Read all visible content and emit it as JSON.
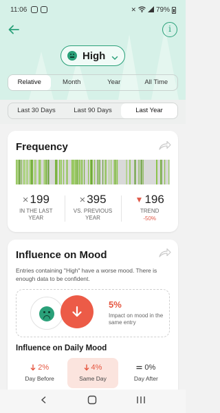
{
  "status_bar": {
    "time": "11:06",
    "battery": "79%"
  },
  "header": {
    "mood_label": "High",
    "mood_color": "#2aa079",
    "range_tabs": [
      {
        "label": "Relative",
        "active": true
      },
      {
        "label": "Month",
        "active": false
      },
      {
        "label": "Year",
        "active": false
      },
      {
        "label": "All Time",
        "active": false
      }
    ],
    "period_tabs": [
      {
        "label": "Last 30 Days",
        "active": false
      },
      {
        "label": "Last 90 Days",
        "active": false
      },
      {
        "label": "Last Year",
        "active": true
      }
    ]
  },
  "frequency": {
    "title": "Frequency",
    "stats": [
      {
        "prefix": "×",
        "value": "199",
        "caption": "IN THE LAST YEAR",
        "sub": ""
      },
      {
        "prefix": "×",
        "value": "395",
        "caption": "VS. PREVIOUS YEAR",
        "sub": ""
      },
      {
        "prefix": "▼",
        "value": "196",
        "caption": "TREND",
        "sub": "-50%"
      }
    ]
  },
  "influence": {
    "title": "Influence on Mood",
    "description": "Entries containing \"High\" have a worse mood. There is enough data to be confident.",
    "impact_percent": "5%",
    "impact_text": "Impact on mood in the same entry",
    "daily_title": "Influence on Daily Mood",
    "daily": [
      {
        "value": "2%",
        "label": "Day Before",
        "direction": "down",
        "highlight": false
      },
      {
        "value": "4%",
        "label": "Same Day",
        "direction": "down",
        "highlight": true
      },
      {
        "value": "0%",
        "label": "Day After",
        "direction": "neutral",
        "highlight": false
      }
    ]
  },
  "colors": {
    "accent": "#2aa079",
    "header_bg": "#d6f1e8",
    "negative": "#e5553f"
  },
  "icons": [
    "back-arrow-icon",
    "info-icon",
    "chevron-down-icon",
    "share-icon",
    "sad-face-icon",
    "arrow-down-icon",
    "nav-back-icon",
    "nav-home-icon",
    "nav-recents-icon"
  ]
}
